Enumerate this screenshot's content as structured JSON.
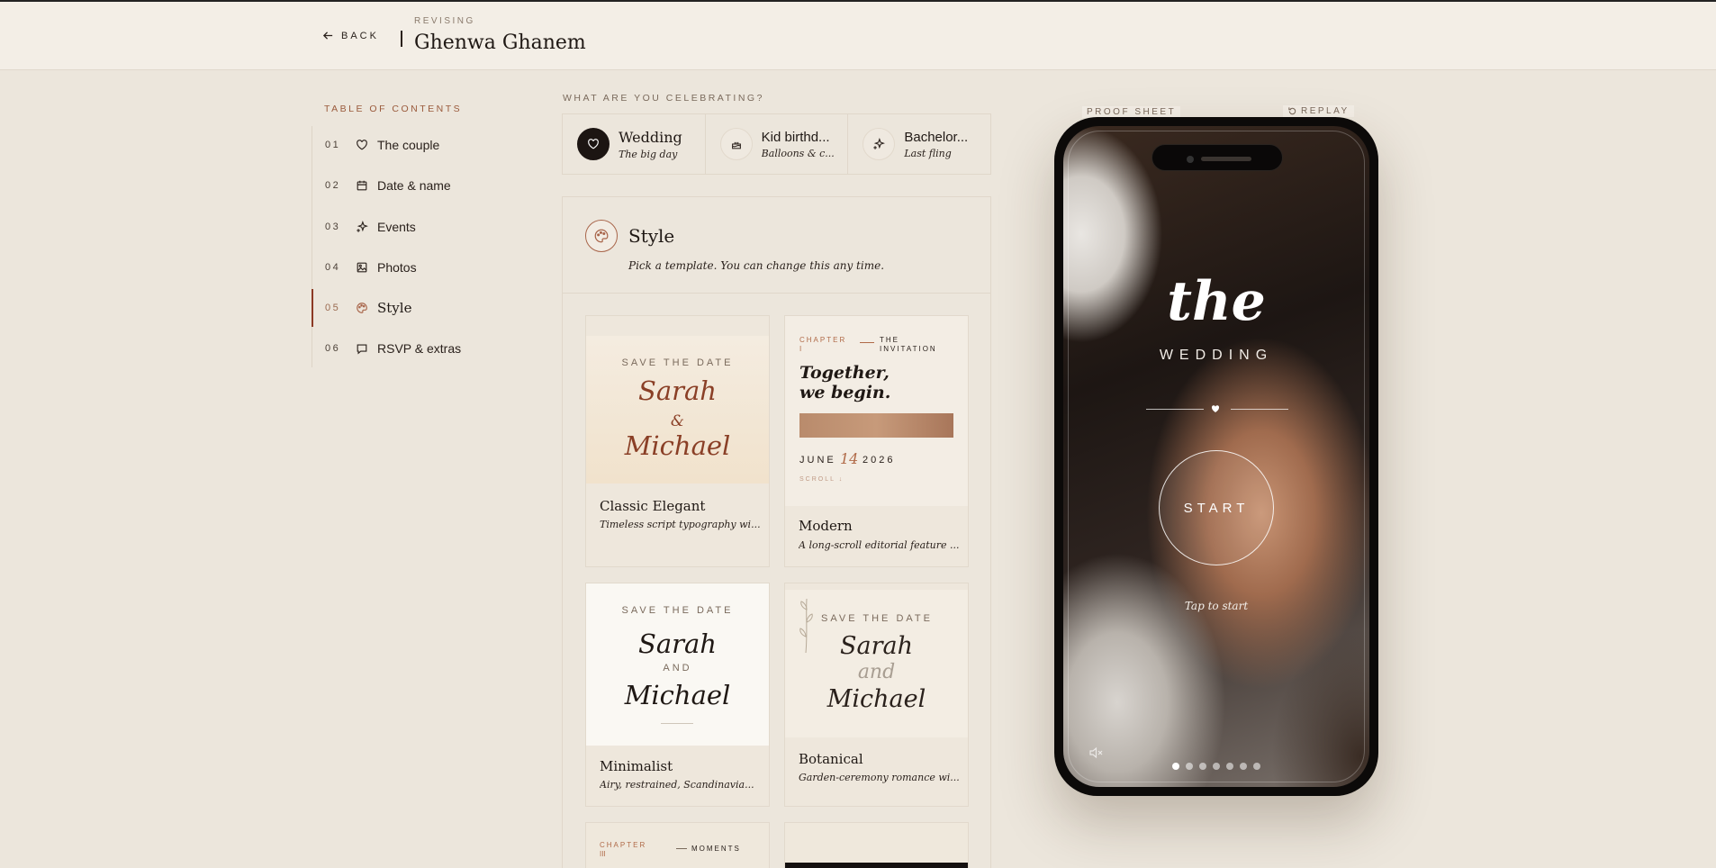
{
  "header": {
    "back_label": "BACK",
    "revising_label": "REVISING",
    "title": "Ghenwa Ghanem"
  },
  "toc": {
    "heading": "TABLE OF CONTENTS",
    "active_index": 4,
    "items": [
      {
        "num": "01",
        "label": "The couple",
        "icon": "heart-icon"
      },
      {
        "num": "02",
        "label": "Date & name",
        "icon": "calendar-icon"
      },
      {
        "num": "03",
        "label": "Events",
        "icon": "sparkle-icon"
      },
      {
        "num": "04",
        "label": "Photos",
        "icon": "image-icon"
      },
      {
        "num": "05",
        "label": "Style",
        "icon": "palette-icon"
      },
      {
        "num": "06",
        "label": "RSVP & extras",
        "icon": "chat-icon"
      }
    ]
  },
  "celebrate": {
    "heading": "WHAT ARE YOU CELEBRATING?",
    "options": [
      {
        "title": "Wedding",
        "subtitle": "The big day",
        "icon": "heart-icon",
        "selected": true
      },
      {
        "title": "Kid birthd...",
        "subtitle": "Balloons & c...",
        "icon": "cake-icon",
        "selected": false
      },
      {
        "title": "Bachelor...",
        "subtitle": "Last fling",
        "icon": "sparkle-icon",
        "selected": false
      }
    ]
  },
  "style_section": {
    "title": "Style",
    "subtitle": "Pick a template. You can change this any time.",
    "templates": [
      {
        "name": "Classic Elegant",
        "desc": "Timeless script typography wi...",
        "preview": {
          "kicker": "SAVE THE DATE",
          "name1": "Sarah",
          "amp": "&",
          "name2": "Michael"
        }
      },
      {
        "name": "Modern",
        "desc": "A long-scroll editorial feature ...",
        "preview": {
          "chapter": "CHAPTER",
          "chapter_num": "I",
          "invitation1": "THE",
          "invitation2": "INVITATION",
          "headline1": "Together,",
          "headline2": "we begin.",
          "month": "JUNE",
          "day": "14",
          "year": "2026",
          "scroll": "SCROLL ↓"
        }
      },
      {
        "name": "Minimalist",
        "desc": "Airy, restrained, Scandinavia...",
        "preview": {
          "kicker": "SAVE THE DATE",
          "name1": "Sarah",
          "and": "AND",
          "name2": "Michael"
        }
      },
      {
        "name": "Botanical",
        "desc": "Garden-ceremony romance wi...",
        "preview": {
          "kicker": "SAVE THE DATE",
          "name1": "Sarah",
          "and": "and",
          "name2": "Michael"
        }
      },
      {
        "name": "",
        "desc": "",
        "preview": {
          "chapter": "CHAPTER",
          "chapter_num": "III",
          "moments": "MOMENTS"
        }
      }
    ]
  },
  "proof": {
    "label": "PROOF SHEET",
    "replay_label": "REPLAY",
    "phone": {
      "the": "the",
      "wedding": "WEDDING",
      "start": "START",
      "tap": "Tap to start",
      "slides": 7,
      "active_slide": 0
    }
  },
  "colors": {
    "accent": "#8c3a25",
    "background": "#ece6dc",
    "header_bg": "#f3eee6"
  }
}
